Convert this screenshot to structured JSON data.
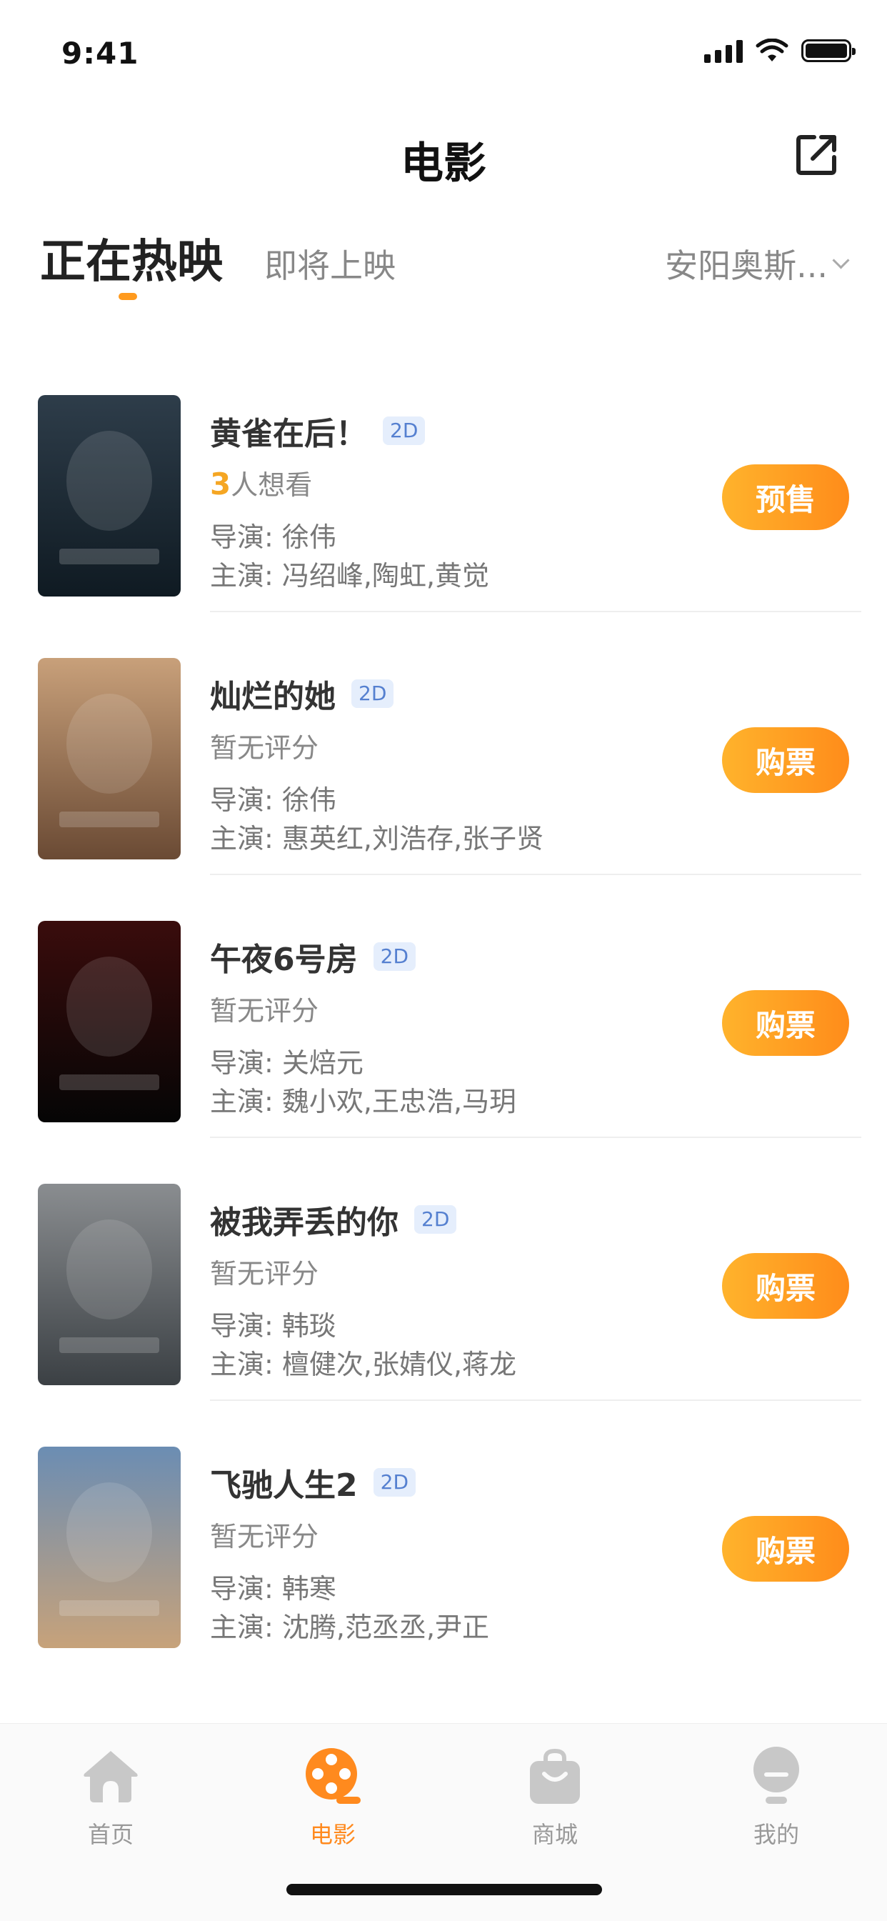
{
  "status_bar": {
    "time": "9:41"
  },
  "header": {
    "title": "电影"
  },
  "tabs": {
    "active": "正在热映",
    "inactive": "即将上映",
    "city": "安阳奥斯..."
  },
  "labels": {
    "director_prefix": "导演: ",
    "cast_prefix": "主演: "
  },
  "movies": [
    {
      "title": "黄雀在后！",
      "format": "2D",
      "want_count": "3",
      "want_suffix": "人想看",
      "rating_text": "",
      "director": "徐伟",
      "cast": " 冯绍峰,陶虹,黄觉",
      "button": "预售",
      "poster_colors": [
        "#2e3d4a",
        "#0f1a22"
      ]
    },
    {
      "title": "灿烂的她",
      "format": "2D",
      "want_count": "",
      "want_suffix": "",
      "rating_text": "暂无评分",
      "director": "徐伟",
      "cast": "惠英红,刘浩存,张子贤",
      "button": "购票",
      "poster_colors": [
        "#c8a07a",
        "#6a4a34"
      ]
    },
    {
      "title": "午夜6号房",
      "format": "2D",
      "want_count": "",
      "want_suffix": "",
      "rating_text": "暂无评分",
      "director": "关焙元",
      "cast": "魏小欢,王忠浩,马玥",
      "button": "购票",
      "poster_colors": [
        "#3a0c0c",
        "#050505"
      ]
    },
    {
      "title": "被我弄丢的你",
      "format": "2D",
      "want_count": "",
      "want_suffix": "",
      "rating_text": "暂无评分",
      "director": "韩琰",
      "cast": " 檀健次,张婧仪,蒋龙",
      "button": "购票",
      "poster_colors": [
        "#8a8d90",
        "#3b4044"
      ]
    },
    {
      "title": "飞驰人生2",
      "format": "2D",
      "want_count": "",
      "want_suffix": "",
      "rating_text": "暂无评分",
      "director": "韩寒",
      "cast": "沈腾,范丞丞,尹正",
      "button": "购票",
      "poster_colors": [
        "#6b8db3",
        "#c7a27a"
      ]
    }
  ],
  "tab_bar": {
    "items": [
      {
        "label": "首页",
        "icon": "home-icon"
      },
      {
        "label": "电影",
        "icon": "film-reel-icon"
      },
      {
        "label": "商城",
        "icon": "shopping-bag-icon"
      },
      {
        "label": "我的",
        "icon": "profile-icon"
      }
    ],
    "active_color": "#ff8a1e",
    "inactive_color": "#c8c8c8"
  }
}
